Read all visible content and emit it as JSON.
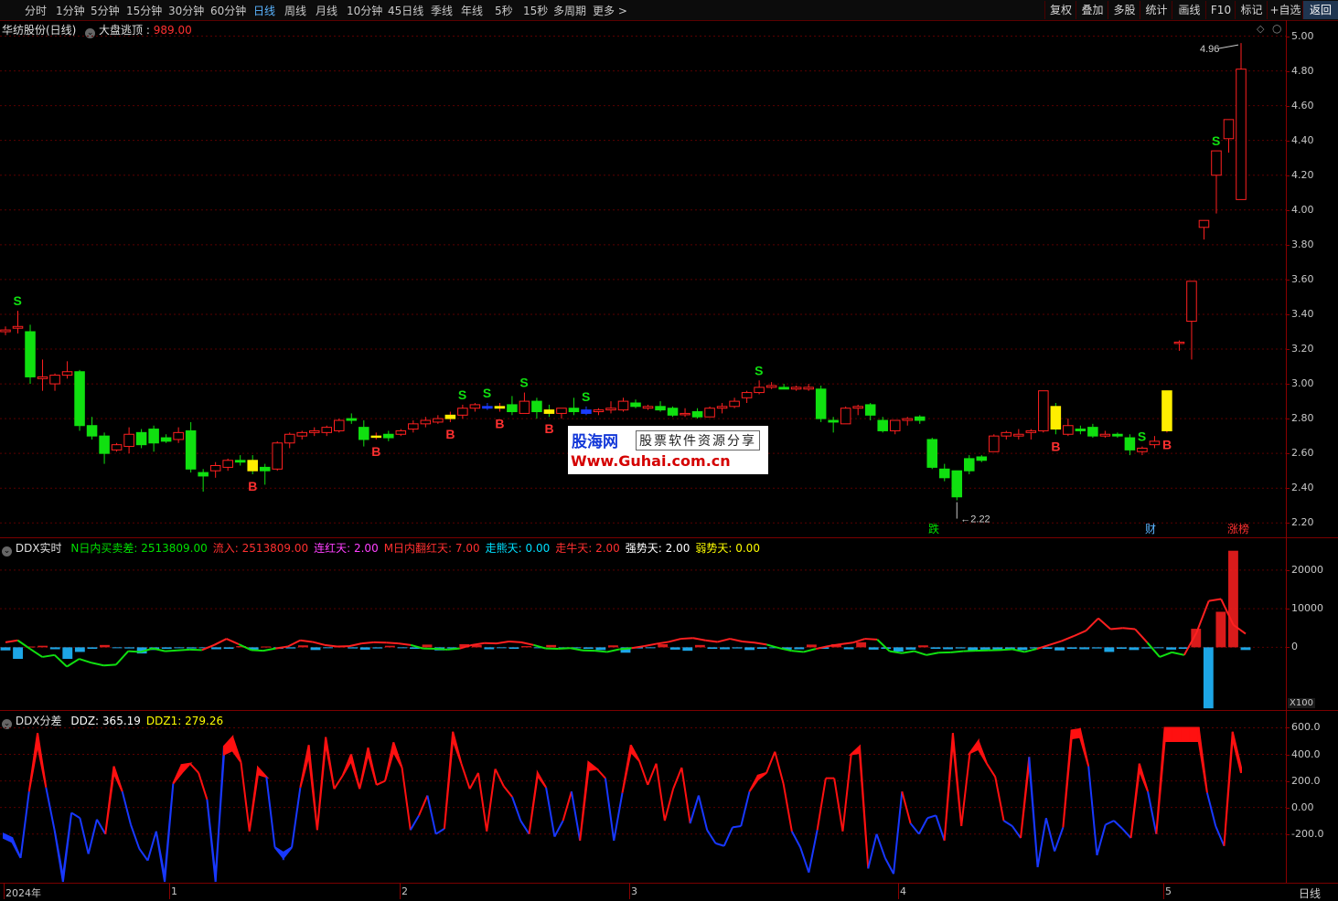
{
  "toolbar": {
    "periods": [
      "分时",
      "1分钟",
      "5分钟",
      "15分钟",
      "30分钟",
      "60分钟",
      "日线",
      "周线",
      "月线",
      "10分钟",
      "45日线",
      "季线",
      "年线",
      "5秒",
      "15秒",
      "多周期",
      "更多 >"
    ],
    "active": "日线",
    "right_buttons": [
      "复权",
      "叠加",
      "多股",
      "统计",
      "画线",
      "F10",
      "标记",
      "+自选",
      "返回"
    ]
  },
  "main_pane": {
    "stock": "华纺股份(日线)",
    "indicator": "大盘逃顶",
    "indicator_value": "989.00",
    "y_ticks": [
      "5.00",
      "4.80",
      "4.60",
      "4.40",
      "4.20",
      "4.00",
      "3.80",
      "3.60",
      "3.40",
      "3.20",
      "3.00",
      "2.80",
      "2.60",
      "2.40",
      "2.20"
    ],
    "high_label": "4.96",
    "low_label": "2.22",
    "tags": [
      {
        "text": "跌",
        "color": "#00e000"
      },
      {
        "text": "财",
        "color": "#5ab4ff"
      },
      {
        "text": "涨榜",
        "color": "#ff3030"
      }
    ],
    "signal_buy": "B",
    "signal_sell": "S"
  },
  "ddx_pane": {
    "title": "DDX实时",
    "fields": [
      {
        "label": "N日内买卖差: 2513809.00",
        "color": "#00e000"
      },
      {
        "label": "流入: 2513809.00",
        "color": "#ff3030"
      },
      {
        "label": "连红天: 2.00",
        "color": "#ff40ff"
      },
      {
        "label": "M日内翻红天: 7.00",
        "color": "#ff3030"
      },
      {
        "label": "走熊天: 0.00",
        "color": "#00e0ff"
      },
      {
        "label": "走牛天: 2.00",
        "color": "#ff3030"
      },
      {
        "label": "强势天: 2.00",
        "color": "#ffffff"
      },
      {
        "label": "弱势天: 0.00",
        "color": "#ffff00"
      }
    ],
    "y_ticks": [
      "20000",
      "10000",
      "0"
    ],
    "scale_label": "X100"
  },
  "ddz_pane": {
    "title": "DDX分差",
    "fields": [
      {
        "label": "DDZ: 365.19",
        "color": "#ffffff"
      },
      {
        "label": "DDZ1: 279.26",
        "color": "#ffff00"
      }
    ],
    "y_ticks": [
      "600.0",
      "400.0",
      "200.0",
      "0.00",
      "-200.0"
    ]
  },
  "x_axis": {
    "labels": [
      "2024年",
      "1",
      "2",
      "3",
      "4",
      "5"
    ],
    "period_label": "日线"
  },
  "watermark": {
    "brand": "股海网",
    "slogan": "股票软件资源分享",
    "url": "Www.Guhai.com.cn"
  },
  "chart_data": [
    {
      "type": "candlestick",
      "title": "华纺股份(日线)",
      "ylim": [
        2.1,
        5.1
      ],
      "grid": true,
      "ohlc": [
        [
          3.3,
          3.33,
          3.28,
          3.31
        ],
        [
          3.32,
          3.42,
          3.29,
          3.33
        ],
        [
          3.3,
          3.34,
          3.0,
          3.04
        ],
        [
          3.03,
          3.14,
          2.96,
          3.04
        ],
        [
          3.0,
          3.06,
          2.96,
          3.05
        ],
        [
          3.05,
          3.13,
          3.03,
          3.07
        ],
        [
          3.07,
          3.08,
          2.73,
          2.76
        ],
        [
          2.76,
          2.81,
          2.68,
          2.7
        ],
        [
          2.7,
          2.72,
          2.54,
          2.6
        ],
        [
          2.62,
          2.66,
          2.61,
          2.65
        ],
        [
          2.64,
          2.75,
          2.6,
          2.71
        ],
        [
          2.72,
          2.74,
          2.63,
          2.65
        ],
        [
          2.74,
          2.76,
          2.61,
          2.66
        ],
        [
          2.69,
          2.71,
          2.66,
          2.67
        ],
        [
          2.68,
          2.75,
          2.66,
          2.72
        ],
        [
          2.73,
          2.78,
          2.49,
          2.51
        ],
        [
          2.49,
          2.51,
          2.38,
          2.47
        ],
        [
          2.5,
          2.55,
          2.46,
          2.53
        ],
        [
          2.52,
          2.57,
          2.5,
          2.56
        ],
        [
          2.56,
          2.59,
          2.53,
          2.55
        ],
        [
          2.56,
          2.59,
          2.48,
          2.5
        ],
        [
          2.52,
          2.54,
          2.42,
          2.5
        ],
        [
          2.51,
          2.67,
          2.5,
          2.66
        ],
        [
          2.66,
          2.72,
          2.63,
          2.71
        ],
        [
          2.7,
          2.73,
          2.68,
          2.72
        ],
        [
          2.72,
          2.75,
          2.7,
          2.73
        ],
        [
          2.72,
          2.76,
          2.7,
          2.75
        ],
        [
          2.73,
          2.8,
          2.72,
          2.79
        ],
        [
          2.8,
          2.83,
          2.77,
          2.79
        ],
        [
          2.75,
          2.79,
          2.64,
          2.68
        ],
        [
          2.7,
          2.72,
          2.68,
          2.7
        ],
        [
          2.71,
          2.73,
          2.67,
          2.69
        ],
        [
          2.71,
          2.74,
          2.7,
          2.73
        ],
        [
          2.74,
          2.79,
          2.72,
          2.77
        ],
        [
          2.77,
          2.81,
          2.75,
          2.79
        ],
        [
          2.78,
          2.82,
          2.77,
          2.8
        ],
        [
          2.8,
          2.84,
          2.78,
          2.82
        ],
        [
          2.82,
          2.88,
          2.8,
          2.86
        ],
        [
          2.86,
          2.89,
          2.84,
          2.88
        ],
        [
          2.87,
          2.89,
          2.85,
          2.86
        ],
        [
          2.86,
          2.89,
          2.84,
          2.87
        ],
        [
          2.88,
          2.93,
          2.82,
          2.84
        ],
        [
          2.83,
          2.95,
          2.83,
          2.9
        ],
        [
          2.9,
          2.92,
          2.8,
          2.84
        ],
        [
          2.85,
          2.88,
          2.81,
          2.83
        ],
        [
          2.83,
          2.86,
          2.8,
          2.86
        ],
        [
          2.86,
          2.92,
          2.82,
          2.84
        ],
        [
          2.85,
          2.87,
          2.82,
          2.83
        ],
        [
          2.84,
          2.86,
          2.82,
          2.85
        ],
        [
          2.85,
          2.9,
          2.83,
          2.86
        ],
        [
          2.85,
          2.92,
          2.84,
          2.9
        ],
        [
          2.89,
          2.91,
          2.86,
          2.87
        ],
        [
          2.86,
          2.88,
          2.85,
          2.87
        ],
        [
          2.87,
          2.9,
          2.84,
          2.85
        ],
        [
          2.86,
          2.87,
          2.81,
          2.82
        ],
        [
          2.83,
          2.86,
          2.81,
          2.83
        ],
        [
          2.84,
          2.86,
          2.8,
          2.81
        ],
        [
          2.81,
          2.87,
          2.81,
          2.86
        ],
        [
          2.86,
          2.89,
          2.83,
          2.87
        ],
        [
          2.87,
          2.92,
          2.86,
          2.9
        ],
        [
          2.92,
          2.96,
          2.89,
          2.95
        ],
        [
          2.95,
          3.02,
          2.94,
          2.98
        ],
        [
          2.98,
          3.01,
          2.97,
          2.99
        ],
        [
          2.98,
          3.0,
          2.97,
          2.97
        ],
        [
          2.97,
          2.99,
          2.96,
          2.98
        ],
        [
          2.97,
          3.0,
          2.96,
          2.98
        ],
        [
          2.97,
          2.99,
          2.78,
          2.8
        ],
        [
          2.79,
          2.81,
          2.72,
          2.78
        ],
        [
          2.77,
          2.87,
          2.77,
          2.86
        ],
        [
          2.86,
          2.88,
          2.82,
          2.87
        ],
        [
          2.88,
          2.89,
          2.79,
          2.82
        ],
        [
          2.79,
          2.81,
          2.72,
          2.73
        ],
        [
          2.73,
          2.79,
          2.71,
          2.79
        ],
        [
          2.79,
          2.81,
          2.76,
          2.8
        ],
        [
          2.81,
          2.82,
          2.77,
          2.79
        ],
        [
          2.68,
          2.69,
          2.51,
          2.52
        ],
        [
          2.51,
          2.54,
          2.44,
          2.46
        ],
        [
          2.5,
          2.5,
          2.33,
          2.35
        ],
        [
          2.57,
          2.59,
          2.48,
          2.5
        ],
        [
          2.58,
          2.59,
          2.55,
          2.56
        ],
        [
          2.61,
          2.71,
          2.61,
          2.7
        ],
        [
          2.7,
          2.73,
          2.68,
          2.72
        ],
        [
          2.7,
          2.74,
          2.68,
          2.71
        ],
        [
          2.72,
          2.74,
          2.68,
          2.73
        ],
        [
          2.73,
          2.96,
          2.72,
          2.96
        ],
        [
          2.87,
          2.89,
          2.71,
          2.74
        ],
        [
          2.71,
          2.8,
          2.7,
          2.76
        ],
        [
          2.74,
          2.76,
          2.71,
          2.73
        ],
        [
          2.75,
          2.77,
          2.69,
          2.7
        ],
        [
          2.7,
          2.73,
          2.69,
          2.71
        ],
        [
          2.71,
          2.72,
          2.69,
          2.7
        ],
        [
          2.69,
          2.71,
          2.59,
          2.62
        ],
        [
          2.61,
          2.64,
          2.59,
          2.63
        ],
        [
          2.65,
          2.7,
          2.63,
          2.67
        ],
        [
          2.73,
          2.96,
          2.72,
          2.96
        ],
        [
          3.24,
          3.25,
          3.19,
          3.24
        ],
        [
          3.36,
          3.59,
          3.14,
          3.59
        ],
        [
          3.9,
          3.94,
          3.83,
          3.94
        ],
        [
          4.2,
          4.34,
          3.98,
          4.34
        ],
        [
          4.41,
          4.52,
          4.33,
          4.52
        ],
        [
          4.06,
          4.96,
          4.06,
          4.81
        ]
      ],
      "signals_sell_at": [
        1,
        37,
        39,
        42,
        47,
        61,
        92,
        98
      ],
      "signals_buy_at": [
        20,
        30,
        36,
        40,
        44,
        85,
        94
      ]
    },
    {
      "type": "bar",
      "title": "DDX实时",
      "ylim": [
        -16000,
        28000
      ],
      "bars": [
        -800,
        -3000,
        200,
        400,
        -500,
        -3000,
        -1200,
        -400,
        600,
        -200,
        -300,
        -1600,
        -700,
        -400,
        -200,
        -300,
        -200,
        -500,
        -400,
        300,
        -600,
        200,
        -400,
        -300,
        500,
        -700,
        -200,
        300,
        -300,
        -600,
        -300,
        400,
        -200,
        -400,
        700,
        -800,
        -300,
        800,
        600,
        -500,
        -200,
        -400,
        300,
        -200,
        600,
        -300,
        -200,
        -400,
        -700,
        500,
        -1400,
        -300,
        -200,
        800,
        -600,
        -900,
        600,
        -400,
        -500,
        -300,
        -700,
        -400,
        -200,
        -600,
        -500,
        700,
        -400,
        800,
        -500,
        1300,
        -600,
        -400,
        -1100,
        -600,
        500,
        -400,
        -500,
        -300,
        -900,
        -600,
        -800,
        -400,
        -700,
        -300,
        -400,
        -800,
        -400,
        -500,
        -300,
        -1200,
        -400,
        -700,
        -300,
        -200,
        -600,
        -400,
        4800,
        -15800,
        9200,
        25000,
        -700
      ],
      "line": [
        1300,
        1800,
        -400,
        -2500,
        -2000,
        -5000,
        -3000,
        -4000,
        -4700,
        -4500,
        -1000,
        -1200,
        -300,
        -1000,
        -800,
        -600,
        -700,
        600,
        2200,
        800,
        -700,
        -900,
        -300,
        200,
        1800,
        1400,
        600,
        200,
        300,
        1000,
        1300,
        1200,
        1000,
        600,
        -300,
        -400,
        -600,
        -300,
        600,
        1100,
        1000,
        1500,
        1300,
        600,
        -300,
        -400,
        -200,
        -800,
        -900,
        -1200,
        -500,
        -200,
        300,
        900,
        1400,
        2200,
        2400,
        1800,
        1400,
        2200,
        1500,
        1200,
        700,
        -200,
        -900,
        -1200,
        -400,
        300,
        800,
        1200,
        2200,
        2000,
        -1000,
        -1500,
        -1000,
        -2000,
        -1400,
        -1300,
        -1000,
        -900,
        -800,
        -700,
        -500,
        -1200,
        -400,
        600,
        1600,
        2900,
        4300,
        7500,
        4700,
        5000,
        4700,
        1200,
        -2500,
        -1300,
        -2000,
        3800,
        12000,
        12500,
        5800,
        3500
      ],
      "ylabel": ""
    },
    {
      "type": "area",
      "title": "DDX分差",
      "ylim": [
        -560,
        720
      ],
      "series": [
        {
          "name": "DDZ",
          "values": [
            -200,
            -230,
            -380,
            120,
            560,
            150,
            -170,
            -560,
            -40,
            -80,
            -350,
            -90,
            -200,
            310,
            120,
            -130,
            -310,
            -400,
            -180,
            -560,
            180,
            320,
            330,
            260,
            60,
            -560,
            460,
            530,
            340,
            -180,
            300,
            230,
            -300,
            -380,
            -300,
            150,
            470,
            -170,
            530,
            140,
            240,
            400,
            140,
            450,
            170,
            200,
            490,
            300,
            -170,
            -60,
            90,
            -200,
            -160,
            570,
            330,
            140,
            260,
            -180,
            290,
            160,
            80,
            -100,
            -200,
            260,
            150,
            -220,
            -100,
            120,
            -250,
            340,
            290,
            220,
            -250,
            110,
            470,
            350,
            170,
            330,
            -100,
            140,
            300,
            -120,
            90,
            -170,
            -270,
            -290,
            -150,
            -140,
            120,
            240,
            260,
            420,
            180,
            -180,
            -300,
            -490,
            -170,
            220,
            220,
            -180,
            400,
            460,
            -460,
            -200,
            -380,
            -500,
            120,
            -120,
            -200,
            -80,
            -60,
            -250,
            560,
            -140,
            410,
            500,
            330,
            230,
            -100,
            -140,
            -230,
            380,
            -450,
            -80,
            -330,
            -150,
            580,
            590,
            310,
            -360,
            -130,
            -100,
            -160,
            -230,
            330,
            120,
            -200,
            600,
            600,
            600,
            600,
            600,
            110,
            -140,
            -290,
            570,
            300
          ]
        },
        {
          "name": "DDZ1",
          "values": [
            -230,
            -260,
            -380,
            120,
            470,
            150,
            -170,
            -520,
            -40,
            -80,
            -350,
            -90,
            -200,
            260,
            120,
            -130,
            -310,
            -400,
            -180,
            -520,
            180,
            260,
            330,
            260,
            60,
            -520,
            400,
            430,
            340,
            -180,
            250,
            230,
            -300,
            -340,
            -300,
            150,
            390,
            -170,
            480,
            140,
            240,
            350,
            140,
            400,
            170,
            200,
            420,
            300,
            -170,
            -60,
            90,
            -200,
            -160,
            510,
            330,
            140,
            260,
            -180,
            290,
            160,
            80,
            -100,
            -200,
            240,
            150,
            -220,
            -100,
            120,
            -250,
            280,
            290,
            220,
            -250,
            110,
            420,
            350,
            170,
            330,
            -100,
            140,
            300,
            -120,
            90,
            -170,
            -270,
            -290,
            -150,
            -140,
            120,
            210,
            260,
            420,
            180,
            -180,
            -300,
            -490,
            -170,
            220,
            220,
            -180,
            400,
            410,
            -460,
            -200,
            -380,
            -500,
            120,
            -120,
            -200,
            -80,
            -60,
            -250,
            500,
            -140,
            410,
            440,
            330,
            230,
            -100,
            -140,
            -230,
            340,
            -450,
            -80,
            -330,
            -150,
            520,
            530,
            310,
            -360,
            -130,
            -100,
            -160,
            -230,
            280,
            120,
            -200,
            500,
            500,
            500,
            500,
            500,
            110,
            -140,
            -290,
            520,
            260
          ]
        }
      ]
    }
  ]
}
